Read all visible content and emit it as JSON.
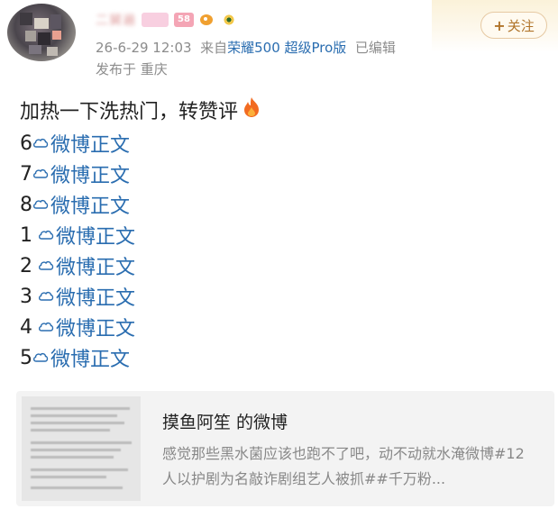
{
  "header": {
    "username": "二舅遍",
    "level_badge": "58",
    "timestamp": "26-6-29 12:03",
    "source_prefix": "来自",
    "device": "荣耀500 超级Pro版",
    "edited": "已编辑",
    "location": "发布于 重庆",
    "follow_plus": "+",
    "follow_label": "关注",
    "icons": [
      "avatar",
      "pig-badge",
      "level-badge",
      "fish-icon",
      "flower-icon",
      "header-decoration"
    ]
  },
  "post": {
    "text": "加热一下洗热门，转赞评",
    "emoji": "flame-icon",
    "lines": [
      {
        "number": "6",
        "label": "微博正文",
        "spaced": false
      },
      {
        "number": "7",
        "label": "微博正文",
        "spaced": false
      },
      {
        "number": "8",
        "label": "微博正文",
        "spaced": false
      },
      {
        "number": "1",
        "label": "微博正文",
        "spaced": true
      },
      {
        "number": "2",
        "label": "微博正文",
        "spaced": true
      },
      {
        "number": "3",
        "label": "微博正文",
        "spaced": true
      },
      {
        "number": "4",
        "label": "微博正文",
        "spaced": true
      },
      {
        "number": "5",
        "label": "微博正文",
        "spaced": false
      }
    ]
  },
  "card": {
    "title": "摸鱼阿笙 的微博",
    "description": "感觉那些黑水菌应该也跑不了吧，动不动就水淹微博#12 人以护剧为名敲诈剧组艺人被抓##千万粉..."
  },
  "colors": {
    "link": "#2a6db0",
    "follow": "#b0742a",
    "meta": "#8c8c8c",
    "card_bg": "#f3f3f3"
  }
}
